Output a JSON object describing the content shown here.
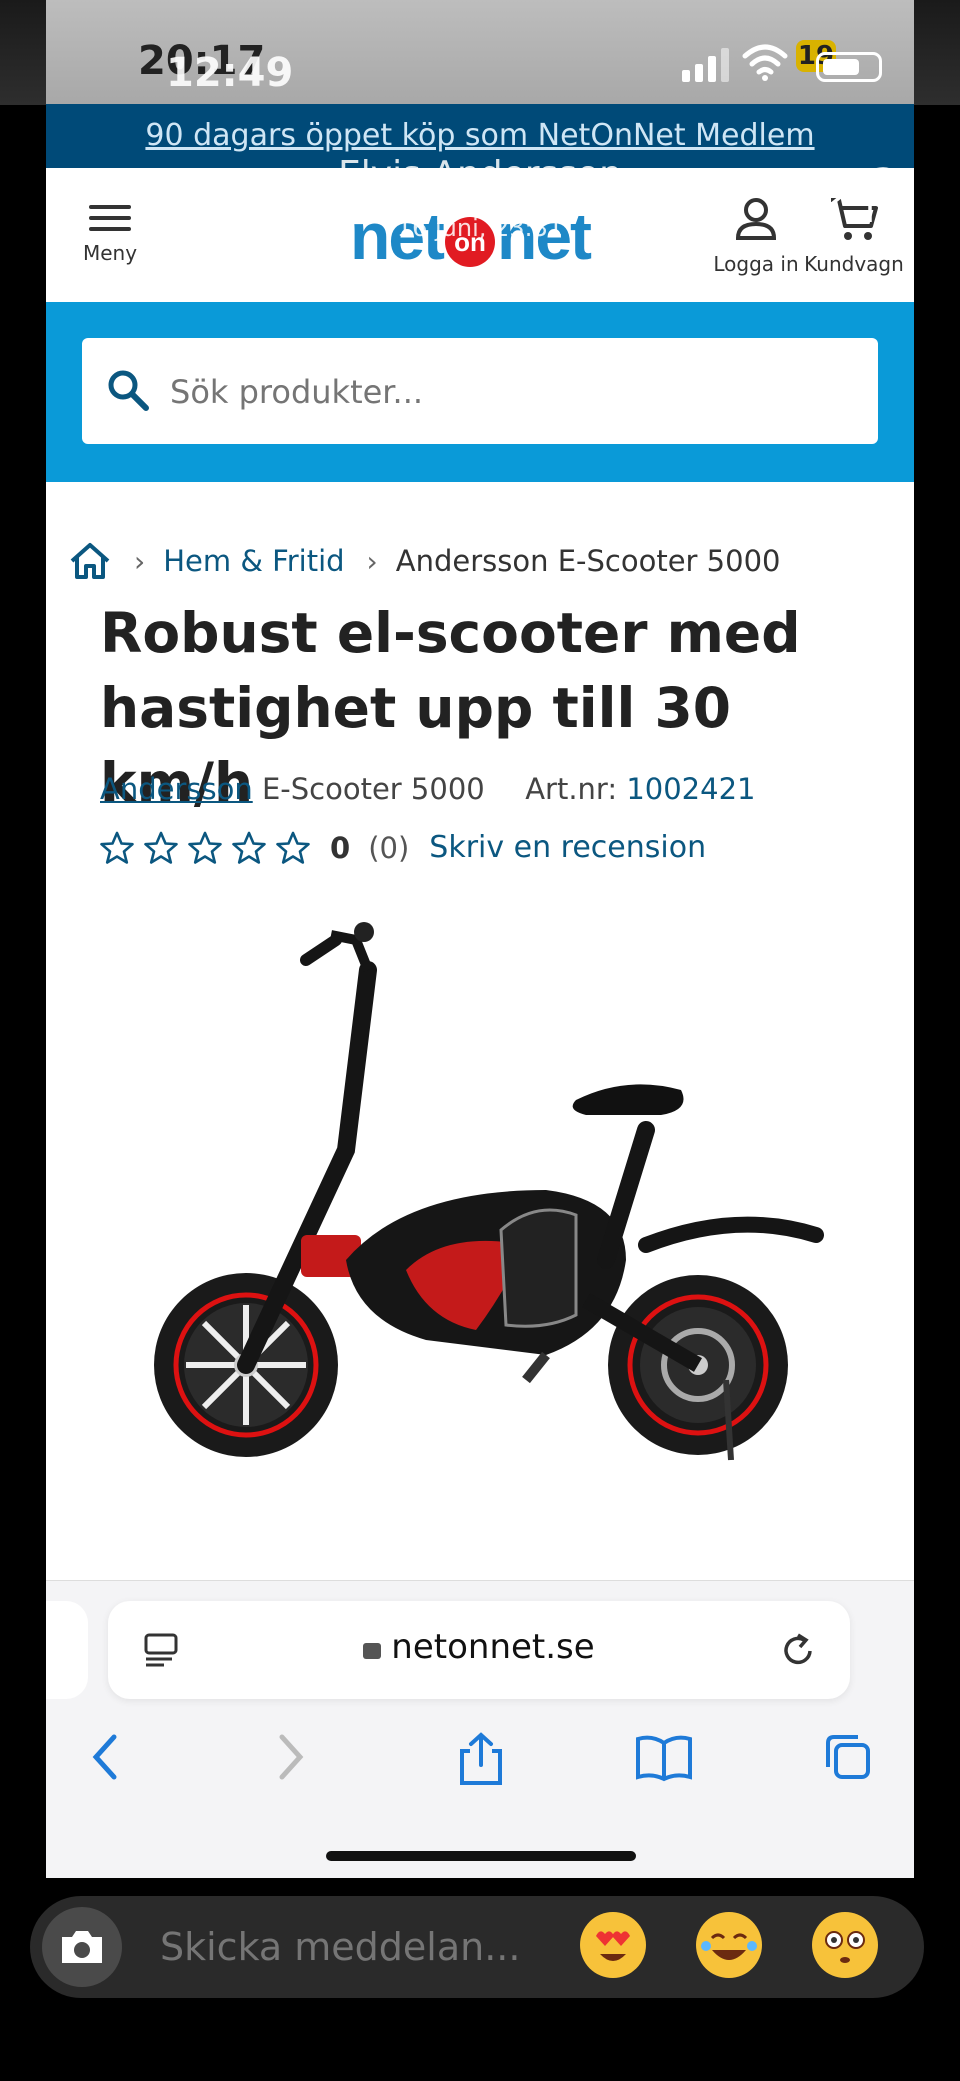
{
  "status_bar": {
    "time": "20:17",
    "story_time": "12:49",
    "battery": "19"
  },
  "promo": {
    "text": "90 dagars öppet köp som NetOnNet Medlem"
  },
  "story": {
    "author": "Elvis Andersson",
    "date": "16 juni, 23:31"
  },
  "header": {
    "logo_left": "net",
    "logo_on": "on",
    "logo_right": "net",
    "menu_label": "Meny",
    "login_label": "Logga in",
    "cart_label": "Kundvagn"
  },
  "search": {
    "placeholder": "Sök produkter..."
  },
  "breadcrumb": {
    "items": [
      "Hem & Fritid",
      "Andersson E-Scooter 5000"
    ]
  },
  "product": {
    "title": "Robust el-scooter med hastighet upp till 30 km/h",
    "brand": "Andersson",
    "model": "E-Scooter 5000",
    "art_label": "Art.nr:",
    "art_number": "1002421",
    "rating_value": "0",
    "rating_count": "(0)",
    "stars_filled": 0,
    "stars_total": 5,
    "review_link": "Skriv en recension"
  },
  "browser": {
    "url": "netonnet.se"
  },
  "reply": {
    "placeholder": "Skicka meddelan..."
  },
  "colors": {
    "brand_blue": "#0a9ad8",
    "promo_bg": "#004a78",
    "link": "#0b5780",
    "logo_red": "#e11b22"
  }
}
